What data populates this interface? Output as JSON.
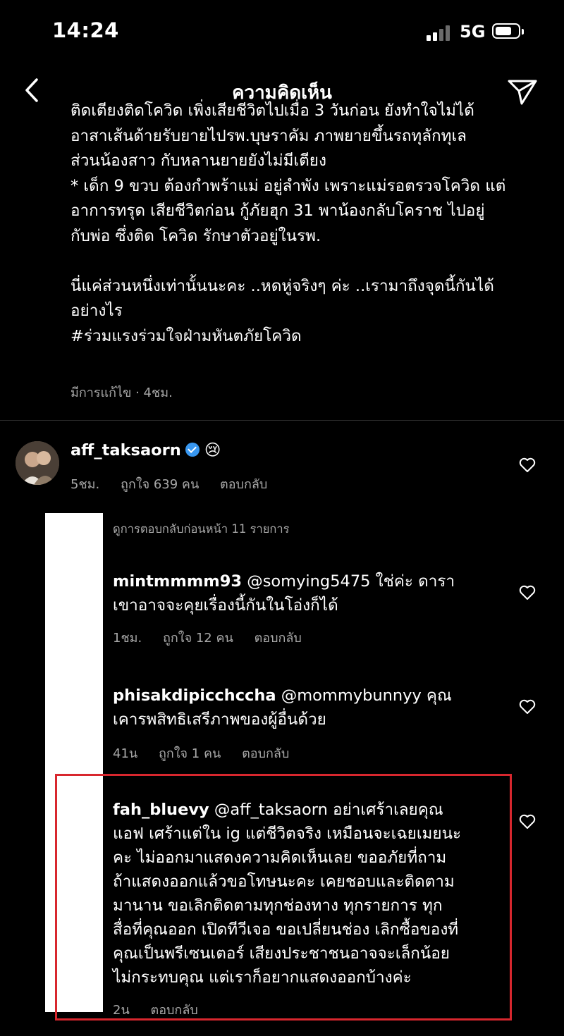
{
  "status_bar": {
    "time": "14:24",
    "network": "5G"
  },
  "nav": {
    "title": "ความคิดเห็น"
  },
  "caption": {
    "text": "ติดเตียงติดโควิด เพิ่งเสียชีวิตไปเมื่อ 3 วันก่อน ยังทำใจไม่ได้\nอาสาเส้นด้ายรับยายไปรพ.บุษราคัม ภาพยายขึ้นรถทุลักทุเล\nส่วนน้องสาว กับหลานยายยังไม่มีเตียง\n* เด็ก 9 ขวบ ต้องกำพร้าแม่ อยู่ลำพัง เพราะแม่รอตรวจโควิด แต่\nอาการทรุด เสียชีวิตก่อน กู้ภัยฮุก 31 พาน้องกลับโคราช ไปอยู่\nกับพ่อ ซึ่งติด โควิด รักษาตัวอยู่ในรพ.\n\nนี่แค่ส่วนหนึ่งเท่านั้นนะคะ ..หดหู่จริงๆ ค่ะ ..เรามาถึงจุดนี้กันได้\nอย่างไร\n#ร่วมแรงร่วมใจฝ่ามหันตภัยโควิด",
    "meta": "มีการแก้ไข · 4ชม."
  },
  "comment": {
    "username": "aff_taksaorn",
    "emoji": "😢",
    "time": "5ชม.",
    "likes": "ถูกใจ 639 คน",
    "reply_label": "ตอบกลับ"
  },
  "view_previous_replies": "ดูการตอบกลับก่อนหน้า 11 รายการ",
  "replies": [
    {
      "username": "mintmmmm93",
      "text": "@somying5475 ใช่ค่ะ ดารา\nเขาอาจจะคุยเรื่องนี้กันในโอ่งก็ได้",
      "time": "1ชม.",
      "likes": "ถูกใจ 12 คน",
      "reply_label": "ตอบกลับ"
    },
    {
      "username": "phisakdipicchccha",
      "text": "@mommybunnyy คุณ\nเคารพสิทธิเสรีภาพของผู้อื่นด้วย",
      "time": "41น",
      "likes": "ถูกใจ 1 คน",
      "reply_label": "ตอบกลับ"
    },
    {
      "username": "fah_bluevy",
      "text": "@aff_taksaorn อย่าเศร้าเลยคุณ\nแอฟ เศร้าแต่ใน ig แต่ชีวิตจริง เหมือนจะเฉยเมยนะ\nคะ ไม่ออกมาแสดงความคิดเห็นเลย ขออภัยที่ถาม\nถ้าแสดงออกแล้วขอโทษนะคะ เคยชอบและติดตาม\nมานาน ขอเลิกติดตามทุกช่องทาง ทุกรายการ ทุก\nสื่อที่คุณออก เปิดทีวีเจอ ขอเปลี่ยนช่อง เลิกซื้อของที่\nคุณเป็นพรีเซนเตอร์ เสียงประชาชนอาจจะเล็กน้อย\nไม่กระทบคุณ แต่เราก็อยากแสดงออกบ้างค่ะ",
      "time": "2น",
      "reply_label": "ตอบกลับ"
    }
  ],
  "colors": {
    "background": "#000000",
    "text": "#ffffff",
    "meta": "#a8a8a8",
    "verified": "#3897f0",
    "highlight": "#d8272e"
  }
}
